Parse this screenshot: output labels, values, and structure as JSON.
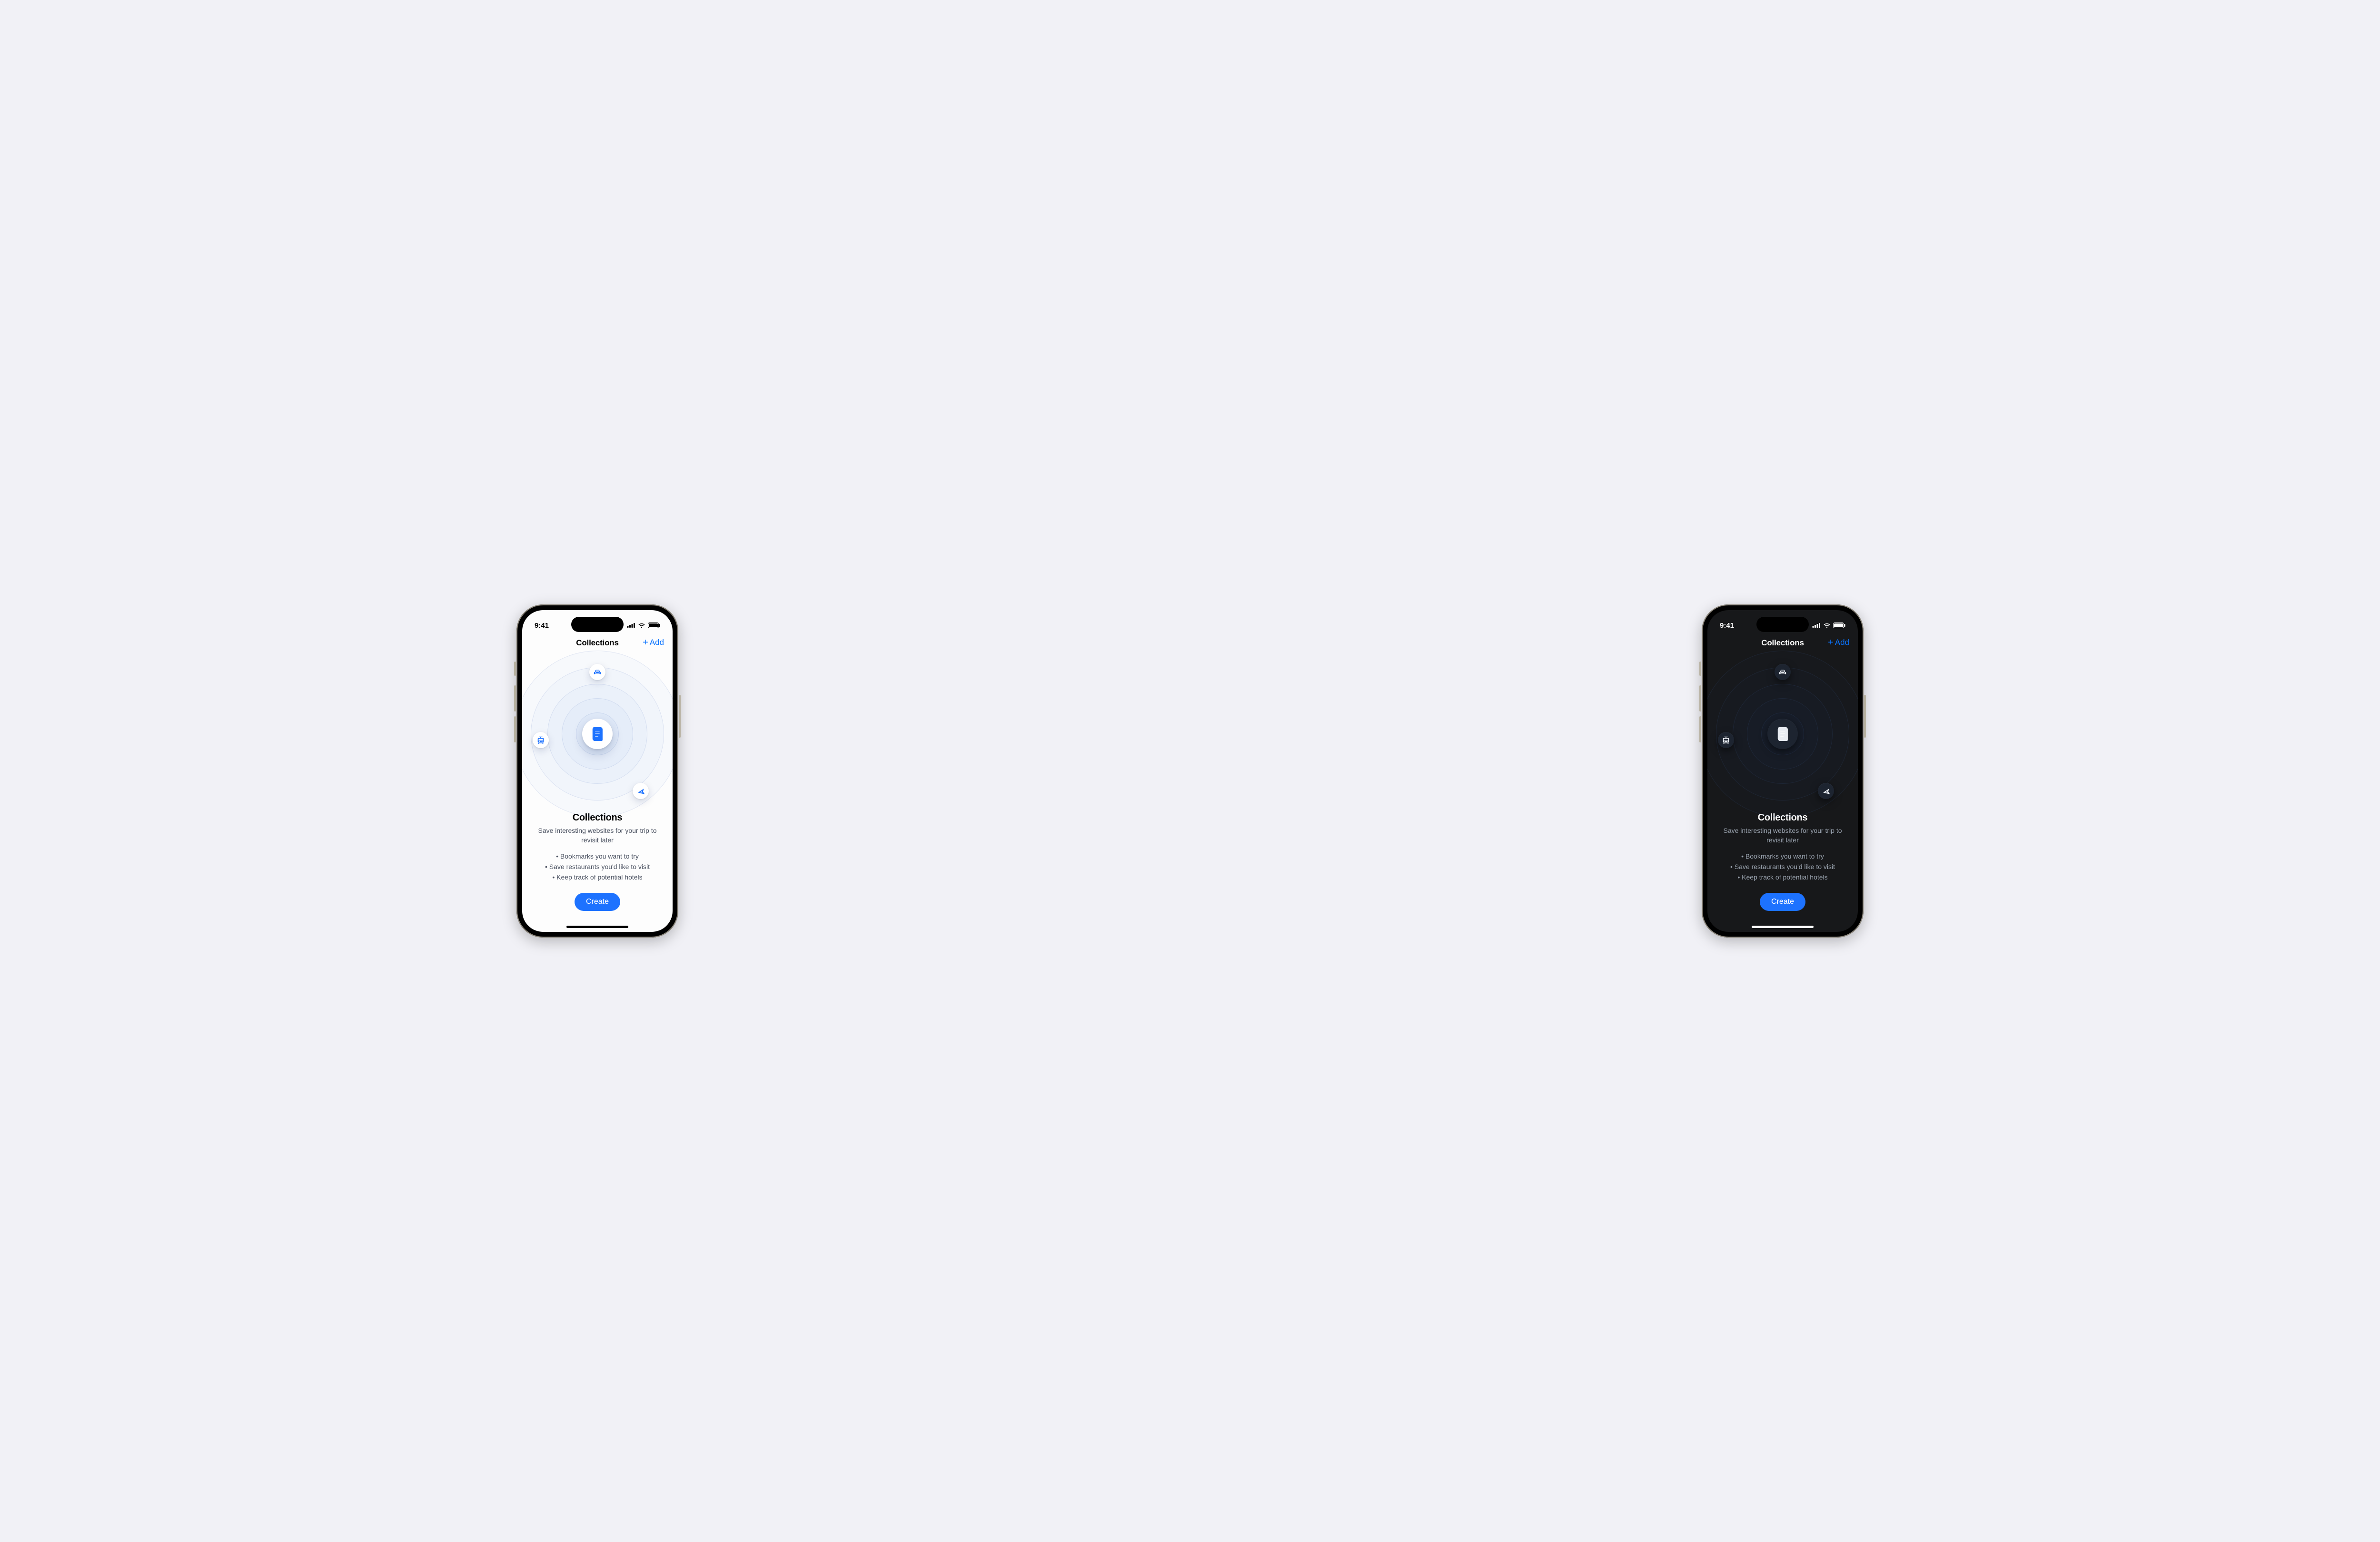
{
  "status": {
    "time": "9:41"
  },
  "nav": {
    "title": "Collections",
    "add_plus": "+",
    "add_label": "Add"
  },
  "icons": {
    "center": "document-icon",
    "car": "car-icon",
    "tram": "tram-icon",
    "plane": "plane-icon"
  },
  "content": {
    "title": "Collections",
    "subtitle": "Save interesting websites for your trip to revisit later",
    "bullets": [
      "Bookmarks you want to try",
      "Save restaurants you'd like to visit",
      "Keep track of potential hotels"
    ],
    "create_label": "Create"
  },
  "colors": {
    "accent": "#1d72ff"
  }
}
